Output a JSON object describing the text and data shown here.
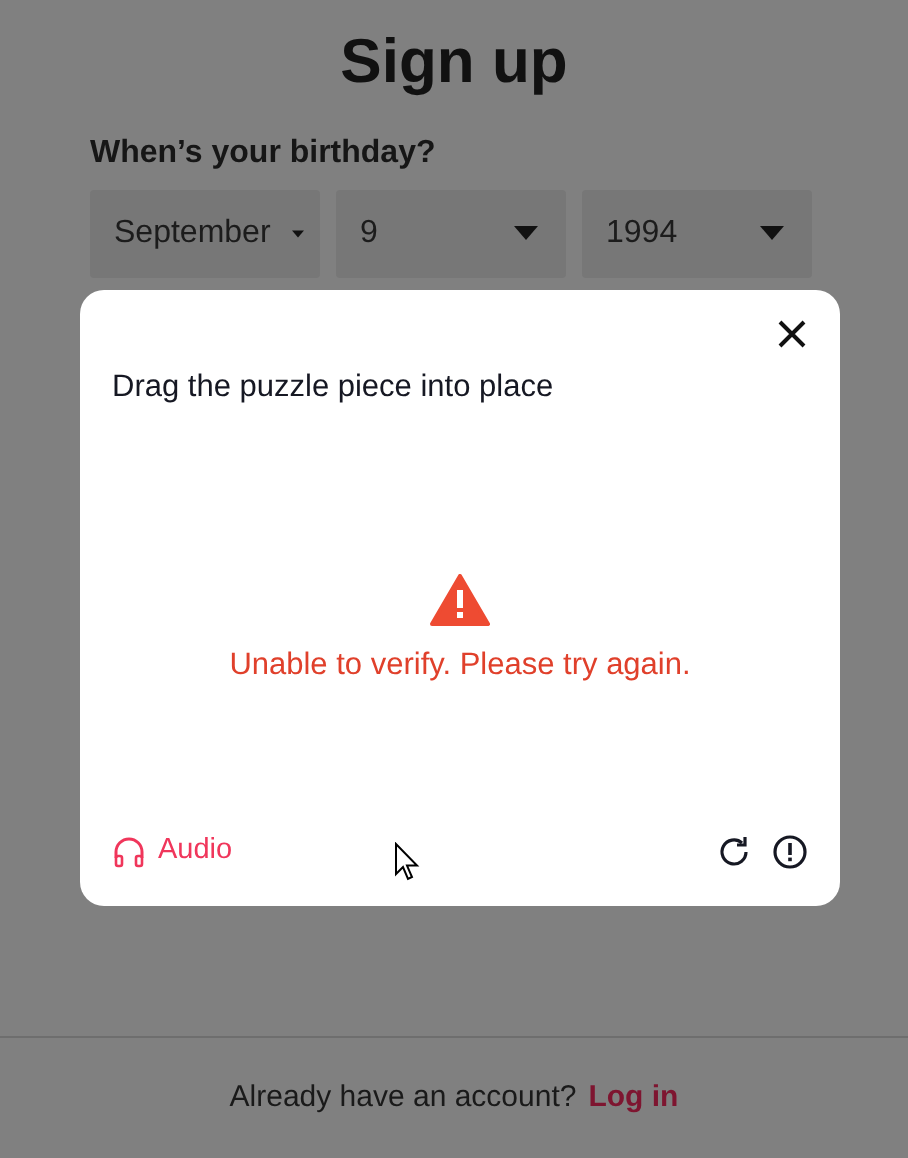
{
  "page": {
    "title": "Sign up",
    "birthday_label": "When’s your birthday?",
    "selects": [
      {
        "value": "September"
      },
      {
        "value": "9"
      },
      {
        "value": "1994"
      }
    ],
    "footer": {
      "text": "Already have an account?",
      "link": "Log in"
    }
  },
  "dialog": {
    "prompt": "Drag the puzzle piece into place",
    "error": "Unable to verify. Please try again.",
    "audio": "Audio"
  }
}
